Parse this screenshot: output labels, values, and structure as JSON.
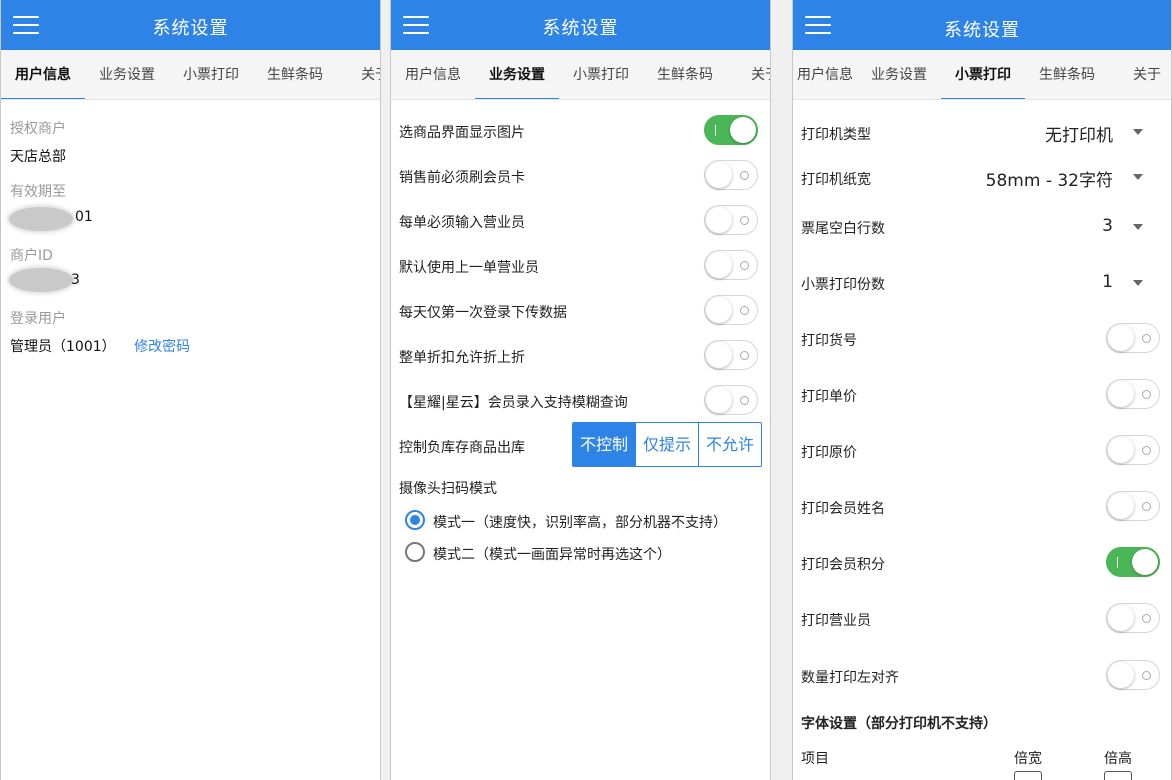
{
  "app": {
    "title": "系统设置"
  },
  "tabs": [
    "用户信息",
    "业务设置",
    "小票打印",
    "生鲜条码",
    "关于"
  ],
  "user_info": {
    "merchant_label": "授权商户",
    "merchant_value": "天店总部",
    "expiry_label": "有效期至",
    "expiry_suffix": "01",
    "merchant_id_label": "商户ID",
    "merchant_id_suffix": "3",
    "login_label": "登录用户",
    "login_value": "管理员（1001）",
    "change_password": "修改密码"
  },
  "business": {
    "toggles": [
      {
        "label": "选商品界面显示图片",
        "on": true
      },
      {
        "label": "销售前必须刷会员卡",
        "on": false
      },
      {
        "label": "每单必须输入营业员",
        "on": false
      },
      {
        "label": "默认使用上一单营业员",
        "on": false
      },
      {
        "label": "每天仅第一次登录下传数据",
        "on": false
      },
      {
        "label": "整单折扣允许折上折",
        "on": false
      },
      {
        "label": "【星耀|星云】会员录入支持模糊查询",
        "on": false
      }
    ],
    "stock_label": "控制负库存商品出库",
    "stock_options": [
      "不控制",
      "仅提示",
      "不允许"
    ],
    "stock_selected": "不控制",
    "scan_label": "摄像头扫码模式",
    "scan_modes": [
      {
        "label": "模式一（速度快，识别率高，部分机器不支持）",
        "checked": true
      },
      {
        "label": "模式二（模式一画面异常时再选这个）",
        "checked": false
      }
    ]
  },
  "printing": {
    "selects": [
      {
        "label": "打印机类型",
        "value": "无打印机"
      },
      {
        "label": "打印机纸宽",
        "value": "58mm - 32字符"
      },
      {
        "label": "票尾空白行数",
        "value": "3"
      },
      {
        "label": "小票打印份数",
        "value": "1"
      }
    ],
    "toggles": [
      {
        "label": "打印货号",
        "on": false
      },
      {
        "label": "打印单价",
        "on": false
      },
      {
        "label": "打印原价",
        "on": false
      },
      {
        "label": "打印会员姓名",
        "on": false
      },
      {
        "label": "打印会员积分",
        "on": true
      },
      {
        "label": "打印营业员",
        "on": false
      },
      {
        "label": "数量打印左对齐",
        "on": false
      }
    ],
    "font_section": "字体设置（部分打印机不支持）",
    "font_col_item": "项目",
    "font_col_wide": "倍宽",
    "font_col_high": "倍高"
  }
}
